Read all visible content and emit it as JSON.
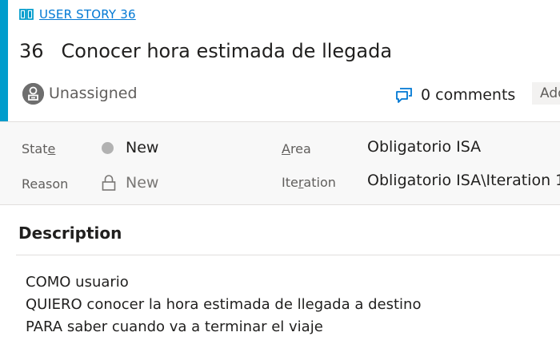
{
  "work_item": {
    "type_label": "USER STORY 36",
    "type_color": "#009ccc",
    "id": "36",
    "title": "Conocer hora estimada de llegada",
    "assignee": "Unassigned",
    "comments_label": "0 comments",
    "add_tag_label": "Add tag"
  },
  "fields": {
    "state_label_prefix": "Stat",
    "state_label_accel": "e",
    "state_value": "New",
    "reason_label": "Reason",
    "reason_value": "New",
    "area_label_accel": "A",
    "area_label_rest": "rea",
    "area_value": "Obligatorio ISA",
    "iteration_label_prefix": "Ite",
    "iteration_label_accel": "r",
    "iteration_label_rest": "ation",
    "iteration_value": "Obligatorio ISA\\Iteration 1"
  },
  "description": {
    "heading": "Description",
    "lines": [
      "COMO usuario",
      "QUIERO conocer la hora estimada de llegada a destino",
      "PARA saber cuando va a terminar el viaje"
    ]
  },
  "icons": {
    "type": "book-icon",
    "assignee": "avatar-icon",
    "comments": "comments-icon",
    "reason": "lock-icon",
    "state": "state-dot-icon"
  }
}
